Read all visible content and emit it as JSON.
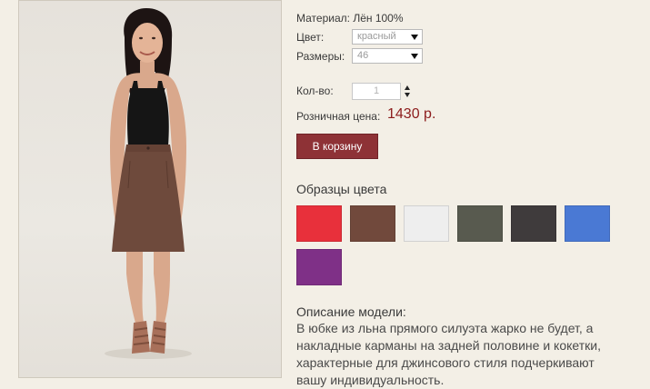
{
  "product": {
    "material_label": "Материал:",
    "material_value": "Лён 100%",
    "color_label": "Цвет:",
    "color_selected": "красный",
    "size_label": "Размеры:",
    "size_selected": "46",
    "qty_label": "Кол-во:",
    "qty_value": "1",
    "price_label": "Розничная цена:",
    "price_value": "1430 р.",
    "add_to_cart": "В корзину"
  },
  "swatches": {
    "title": "Образцы цвета",
    "items": [
      {
        "name": "red",
        "color": "#e8303b"
      },
      {
        "name": "brown",
        "color": "#71493c"
      },
      {
        "name": "white",
        "color": "#eeeeee"
      },
      {
        "name": "olive-gray",
        "color": "#585a4f"
      },
      {
        "name": "charcoal",
        "color": "#3f3b3c"
      },
      {
        "name": "blue",
        "color": "#4a79d4"
      },
      {
        "name": "purple",
        "color": "#7f3087"
      }
    ]
  },
  "description": {
    "title": "Описание модели:",
    "text": "В юбке из льна прямого силуэта жарко не будет, а накладные карманы на задней половине и кокетки, характерные для джинсового стиля подчеркивают вашу индивидуальность."
  },
  "colors": {
    "accent_button": "#8e3236",
    "price": "#8c1c1c",
    "background": "#f3efe6"
  },
  "icons": {
    "select_arrow": "chevron-down-icon",
    "spinner_up": "arrow-up-icon",
    "spinner_down": "arrow-down-icon"
  }
}
